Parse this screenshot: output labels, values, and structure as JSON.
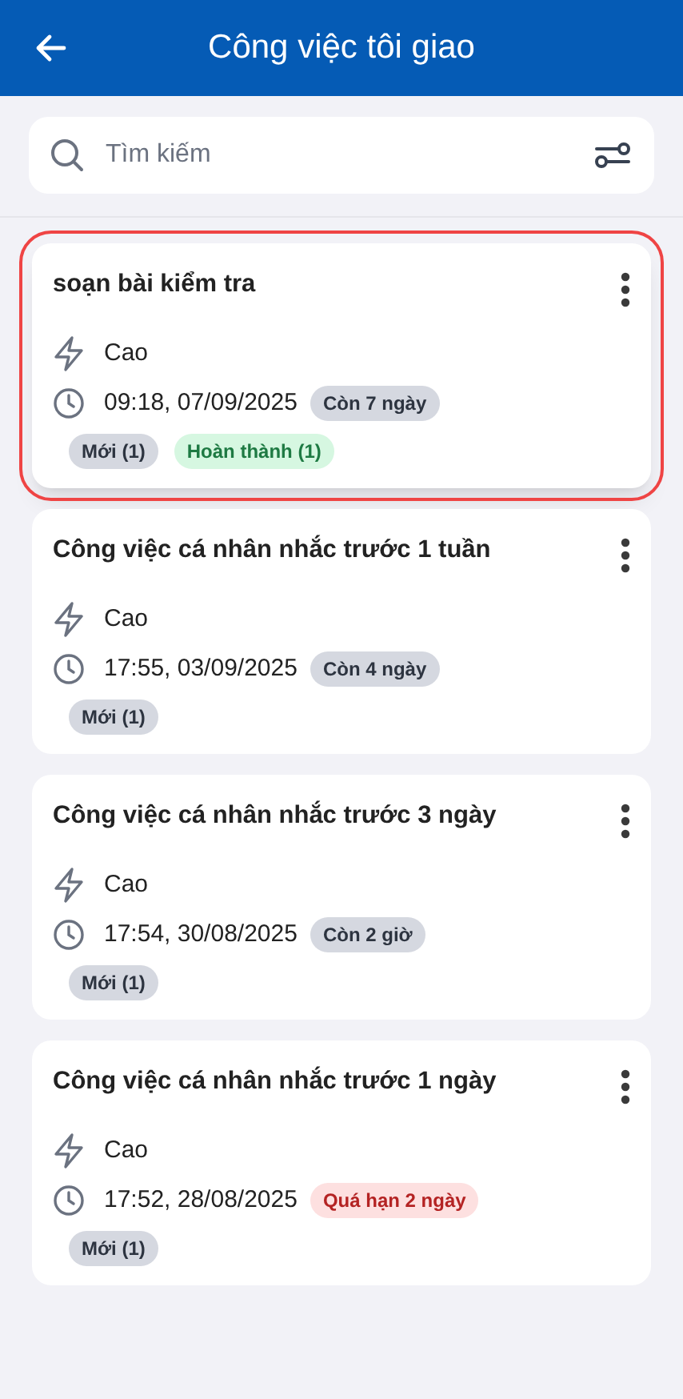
{
  "header": {
    "title": "Công việc tôi giao"
  },
  "search": {
    "placeholder": "Tìm kiếm"
  },
  "tasks": [
    {
      "title": "soạn bài kiểm tra",
      "selected": true,
      "priority": "Cao",
      "due": "09:18, 07/09/2025",
      "deadline": {
        "text": "Còn 7 ngày",
        "kind": "neutral"
      },
      "statuses": [
        {
          "text": "Mới (1)",
          "kind": "neutral"
        },
        {
          "text": "Hoàn thành (1)",
          "kind": "done"
        }
      ]
    },
    {
      "title": "Công việc cá nhân nhắc trước 1 tuần",
      "selected": false,
      "priority": "Cao",
      "due": "17:55, 03/09/2025",
      "deadline": {
        "text": "Còn 4 ngày",
        "kind": "neutral"
      },
      "statuses": [
        {
          "text": "Mới (1)",
          "kind": "neutral"
        }
      ]
    },
    {
      "title": "Công việc cá nhân nhắc trước 3 ngày",
      "selected": false,
      "priority": "Cao",
      "due": "17:54, 30/08/2025",
      "deadline": {
        "text": "Còn 2 giờ",
        "kind": "neutral"
      },
      "statuses": [
        {
          "text": "Mới (1)",
          "kind": "neutral"
        }
      ]
    },
    {
      "title": "Công việc cá nhân nhắc trước 1 ngày",
      "selected": false,
      "priority": "Cao",
      "due": "17:52, 28/08/2025",
      "deadline": {
        "text": "Quá hạn 2 ngày",
        "kind": "overdue"
      },
      "statuses": [
        {
          "text": "Mới (1)",
          "kind": "neutral"
        }
      ]
    }
  ]
}
